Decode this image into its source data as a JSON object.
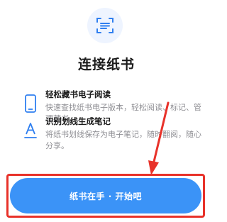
{
  "header": {
    "icon": "scan-frame-icon",
    "title": "连接纸书"
  },
  "features": [
    {
      "icon": "phone-icon",
      "title": "轻松藏书电子阅读",
      "description": "快速查找纸书电子版本，轻松阅读、标记、管理藏书。"
    },
    {
      "icon": "text-underline-icon",
      "title": "识别划线生成笔记",
      "description": "将纸书划线保存为电子笔记，随时翻阅，随心分享。"
    }
  ],
  "cta": {
    "label": "纸书在手 · 开始吧"
  },
  "colors": {
    "accent": "#3b93f7",
    "annotation": "#e8322a",
    "icon_blue": "#2f7ff0"
  }
}
